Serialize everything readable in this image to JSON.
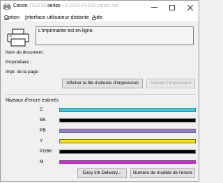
{
  "window": {
    "title_prefix": "Canon",
    "title_series": "series -",
    "title_redacted_1": "TS3100",
    "title_redacted_2": "3-2010-P1000.canon.net"
  },
  "menu": {
    "items": [
      {
        "underline": "O",
        "rest": "ption"
      },
      {
        "underline": "I",
        "rest": "nterface utilisateur distante"
      },
      {
        "underline": "A",
        "rest": "ide"
      }
    ]
  },
  "status": {
    "message": "L'imprimante est en ligne."
  },
  "fields": {
    "document": "Nom du document :",
    "owner": "Propriétaire :",
    "page": "Impr. de la page :"
  },
  "buttons": {
    "queue": "Afficher la file d'attente d'impression",
    "cancel": "Annuler l'impression",
    "easy_ink": "Easy Ink Delivery...",
    "model": "Numéro de modèle de l'encre"
  },
  "ink": {
    "title": "Niveaux d'encre estimés",
    "levels": [
      {
        "name": "C",
        "color": "#1fd6f4"
      },
      {
        "name": "BK",
        "color": "#000000"
      },
      {
        "name": "PB",
        "color": "#9a78d8"
      },
      {
        "name": "Y",
        "color": "#fde100"
      },
      {
        "name": "PGBK",
        "color": "#000000"
      },
      {
        "name": "M",
        "color": "#e020e0"
      }
    ]
  }
}
